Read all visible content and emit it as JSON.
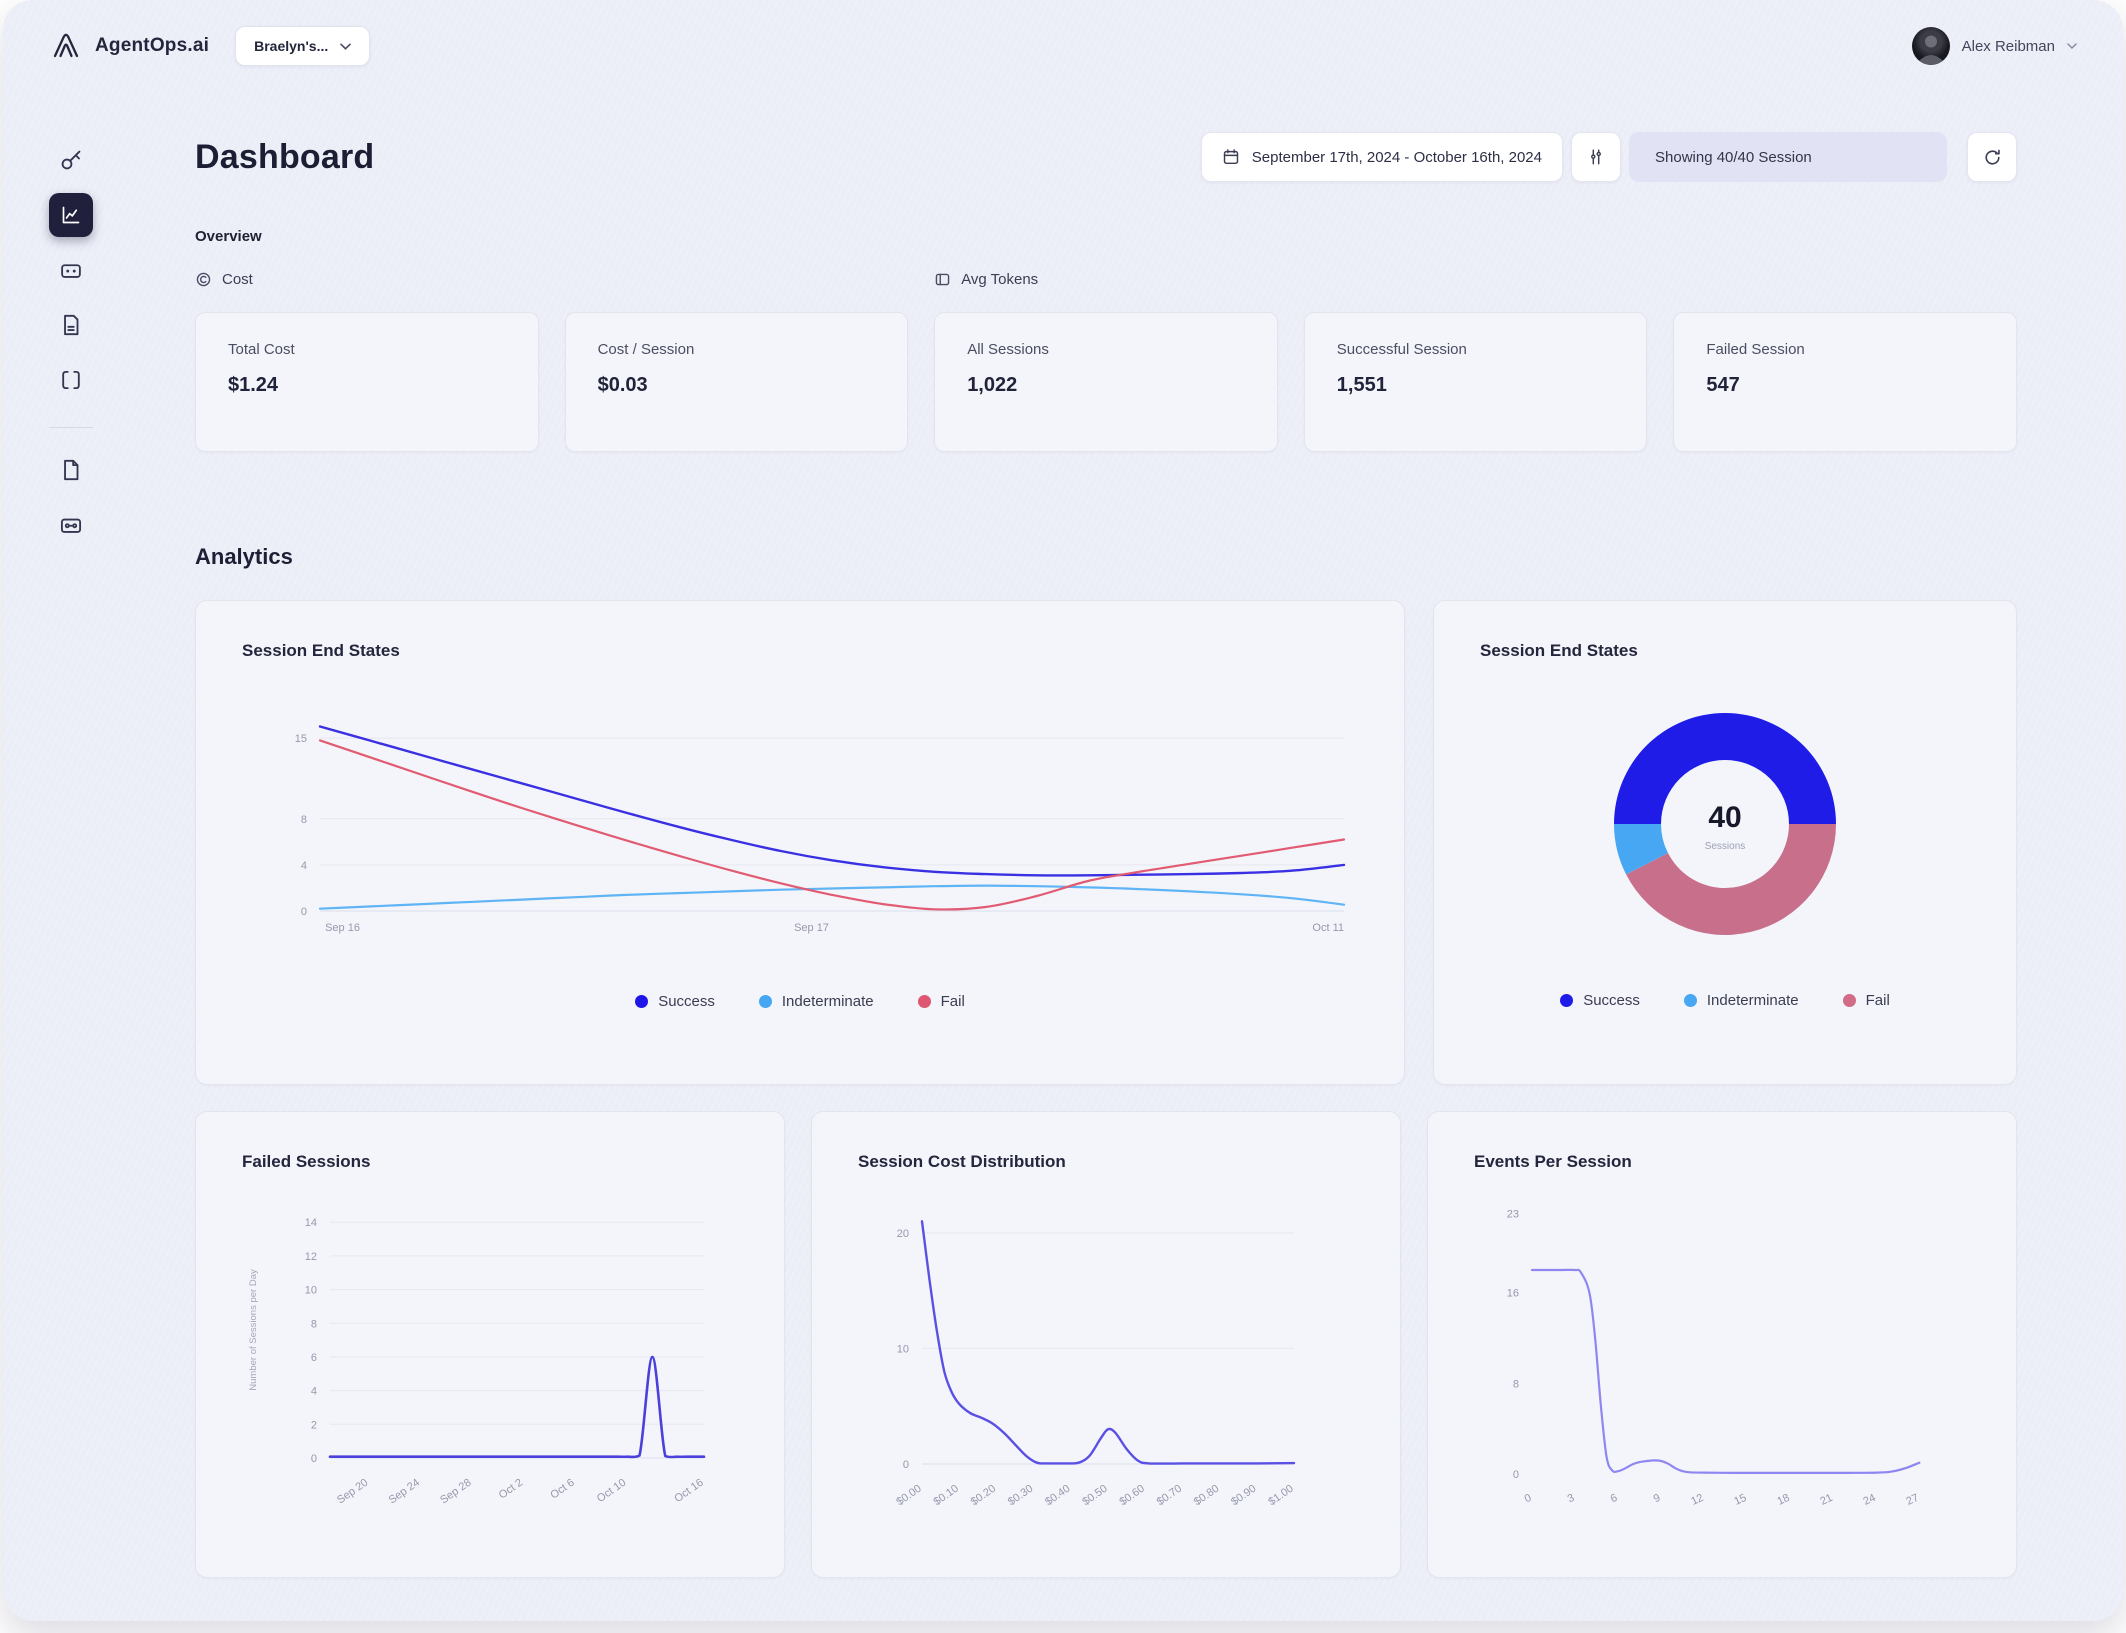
{
  "app": {
    "brand": "AgentOps.ai",
    "workspace": "Braelyn's...",
    "user_name": "Alex Reibman"
  },
  "toolbar": {
    "date_range": "September 17th, 2024 - October 16th, 2024",
    "showing": "Showing 40/40 Session"
  },
  "page": {
    "title": "Dashboard",
    "overview_heading": "Overview",
    "analytics_heading": "Analytics",
    "toggle_cost": "Cost",
    "toggle_tokens": "Avg Tokens"
  },
  "overview_cards": [
    {
      "label": "Total Cost",
      "value": "$1.24"
    },
    {
      "label": "Cost / Session",
      "value": "$0.03"
    },
    {
      "label": "All Sessions",
      "value": "1,022"
    },
    {
      "label": "Successful Session",
      "value": "1,551"
    },
    {
      "label": "Failed Session",
      "value": "547"
    }
  ],
  "chart_data": [
    {
      "id": "session-end-states-line",
      "type": "line",
      "title": "Session End States",
      "xlim": [
        0,
        1
      ],
      "ylim": [
        0,
        17
      ],
      "grid": true,
      "margins": {
        "l": 78,
        "r": 14,
        "t": 14,
        "b": 42
      },
      "yticks": [
        {
          "v": 15,
          "label": "15"
        },
        {
          "v": 8,
          "label": "8"
        },
        {
          "v": 4,
          "label": "4"
        },
        {
          "v": 0,
          "label": "0"
        }
      ],
      "xticks": [
        {
          "v": 0.005,
          "label": "Sep 16",
          "anchor": "start"
        },
        {
          "v": 0.48,
          "label": "Sep 17"
        },
        {
          "v": 1,
          "label": "Oct 11",
          "anchor": "end"
        }
      ],
      "legend": [
        {
          "name": "Success",
          "color": "#2015e8"
        },
        {
          "name": "Indeterminate",
          "color": "#45a7f2"
        },
        {
          "name": "Fail",
          "color": "#dd5672"
        }
      ],
      "series": [
        {
          "name": "Success",
          "color": "#3a30e3",
          "width": 2.4,
          "values": [
            16,
            14.75,
            13.5,
            12.25,
            11.0,
            9.75,
            8.5,
            7.3,
            6.2,
            5.2,
            4.4,
            3.8,
            3.4,
            3.2,
            3.1,
            3.1,
            3.15,
            3.2,
            3.3,
            3.5,
            4.0
          ]
        },
        {
          "name": "Indeterminate",
          "color": "#5fb4f5",
          "width": 2.2,
          "values": [
            0.2,
            0.4,
            0.6,
            0.8,
            1.0,
            1.2,
            1.4,
            1.55,
            1.7,
            1.85,
            1.95,
            2.05,
            2.15,
            2.2,
            2.15,
            2.05,
            1.9,
            1.7,
            1.45,
            1.1,
            0.55
          ]
        },
        {
          "name": "Fail",
          "color": "#e15b72",
          "width": 2.2,
          "values": [
            14.8,
            13.3,
            11.8,
            10.3,
            8.85,
            7.45,
            6.1,
            4.8,
            3.55,
            2.4,
            1.4,
            0.6,
            0.15,
            0.35,
            1.3,
            2.6,
            3.4,
            4.1,
            4.8,
            5.5,
            6.2
          ]
        }
      ]
    },
    {
      "id": "session-end-states-donut",
      "type": "donut",
      "title": "Session End States",
      "size": 222,
      "inner": 64,
      "start": 180,
      "center_value": "40",
      "center_label": "Sessions",
      "slices": [
        {
          "name": "Success",
          "value": 20,
          "color": "#1f1ce8"
        },
        {
          "name": "Fail",
          "value": 17,
          "color": "#c76f8b"
        },
        {
          "name": "Indeterminate",
          "value": 3,
          "color": "#47a7f2"
        }
      ],
      "legend": [
        {
          "name": "Success",
          "color": "#1f1ce8"
        },
        {
          "name": "Indeterminate",
          "color": "#47a7f2"
        },
        {
          "name": "Fail",
          "color": "#d16b86"
        }
      ]
    },
    {
      "id": "failed-sessions",
      "type": "line",
      "title": "Failed Sessions",
      "ylabel": "Number of Sessions per Day",
      "xlim": [
        0,
        29
      ],
      "ylim": [
        0,
        15.2
      ],
      "grid": true,
      "x_rotate": -35,
      "margins": {
        "l": 88,
        "r": 34,
        "t": 16,
        "b": 80
      },
      "yticks": [
        {
          "v": 14,
          "label": "14"
        },
        {
          "v": 12,
          "label": "12"
        },
        {
          "v": 10,
          "label": "10"
        },
        {
          "v": 8,
          "label": "8"
        },
        {
          "v": 6,
          "label": "6"
        },
        {
          "v": 4,
          "label": "4"
        },
        {
          "v": 2,
          "label": "2"
        },
        {
          "v": 0,
          "label": "0"
        }
      ],
      "xticks": [
        {
          "v": 3,
          "label": "Sep 20"
        },
        {
          "v": 7,
          "label": "Sep 24"
        },
        {
          "v": 11,
          "label": "Sep 28"
        },
        {
          "v": 15,
          "label": "Oct 2"
        },
        {
          "v": 19,
          "label": "Oct 6"
        },
        {
          "v": 23,
          "label": "Oct 10"
        },
        {
          "v": 29,
          "label": "Oct 16"
        }
      ],
      "series": [
        {
          "name": "Failed Sessions",
          "color": "#4c40dc",
          "width": 2.6,
          "values": [
            0.08,
            0.08,
            0.08,
            0.08,
            0.08,
            0.08,
            0.08,
            0.08,
            0.08,
            0.08,
            0.08,
            0.08,
            0.08,
            0.08,
            0.08,
            0.08,
            0.08,
            0.08,
            0.08,
            0.08,
            0.08,
            0.08,
            0.08,
            0.08,
            0.15,
            6,
            0.12,
            0.08,
            0.08,
            0.08
          ]
        }
      ]
    },
    {
      "id": "session-cost-distribution",
      "type": "line",
      "title": "Session Cost Distribution",
      "xlim": [
        0,
        1.0
      ],
      "ylim": [
        0,
        22.5
      ],
      "grid": true,
      "x_rotate": -35,
      "margins": {
        "l": 64,
        "r": 60,
        "t": 18,
        "b": 74
      },
      "yticks": [
        {
          "v": 20,
          "label": "20"
        },
        {
          "v": 10,
          "label": "10"
        },
        {
          "v": 0,
          "label": "0"
        }
      ],
      "xticks": [
        {
          "v": 0,
          "label": "$0.00"
        },
        {
          "v": 0.1,
          "label": "$0.10"
        },
        {
          "v": 0.2,
          "label": "$0.20"
        },
        {
          "v": 0.3,
          "label": "$0.30"
        },
        {
          "v": 0.4,
          "label": "$0.40"
        },
        {
          "v": 0.5,
          "label": "$0.50"
        },
        {
          "v": 0.6,
          "label": "$0.60"
        },
        {
          "v": 0.7,
          "label": "$0.70"
        },
        {
          "v": 0.8,
          "label": "$0.80"
        },
        {
          "v": 0.9,
          "label": "$0.90"
        },
        {
          "v": 1.0,
          "label": "$1.00"
        }
      ],
      "series": [
        {
          "name": "Sessions",
          "color": "#5a50e4",
          "width": 2.4,
          "values": [
            [
              0,
              21
            ],
            [
              0.02,
              16
            ],
            [
              0.04,
              11.5
            ],
            [
              0.06,
              8
            ],
            [
              0.08,
              6.2
            ],
            [
              0.1,
              5.2
            ],
            [
              0.13,
              4.4
            ],
            [
              0.16,
              4.0
            ],
            [
              0.19,
              3.5
            ],
            [
              0.22,
              2.7
            ],
            [
              0.25,
              1.7
            ],
            [
              0.28,
              0.7
            ],
            [
              0.31,
              0.1
            ],
            [
              0.34,
              0.05
            ],
            [
              0.38,
              0.05
            ],
            [
              0.42,
              0.1
            ],
            [
              0.45,
              0.7
            ],
            [
              0.48,
              2.2
            ],
            [
              0.5,
              3.0
            ],
            [
              0.52,
              2.7
            ],
            [
              0.55,
              1.3
            ],
            [
              0.58,
              0.3
            ],
            [
              0.61,
              0.05
            ],
            [
              0.7,
              0.05
            ],
            [
              0.8,
              0.05
            ],
            [
              0.9,
              0.05
            ],
            [
              1.0,
              0.08
            ]
          ]
        }
      ]
    },
    {
      "id": "events-per-session",
      "type": "line",
      "title": "Events Per Session",
      "xlim": [
        0,
        27.6
      ],
      "ylim": [
        0,
        24
      ],
      "grid": false,
      "x_rotate": -25,
      "margins": {
        "l": 58,
        "r": 42,
        "t": 16,
        "b": 64
      },
      "yticks": [
        {
          "v": 23,
          "label": "23"
        },
        {
          "v": 16,
          "label": "16"
        },
        {
          "v": 8,
          "label": "8"
        },
        {
          "v": 0,
          "label": "0"
        }
      ],
      "xticks": [
        {
          "v": 0,
          "label": "0"
        },
        {
          "v": 3,
          "label": "3"
        },
        {
          "v": 6,
          "label": "6"
        },
        {
          "v": 9,
          "label": "9"
        },
        {
          "v": 12,
          "label": "12"
        },
        {
          "v": 15,
          "label": "15"
        },
        {
          "v": 18,
          "label": "18"
        },
        {
          "v": 21,
          "label": "21"
        },
        {
          "v": 24,
          "label": "24"
        },
        {
          "v": 27,
          "label": "27"
        }
      ],
      "series": [
        {
          "name": "Events",
          "color": "#8e87f1",
          "width": 2.2,
          "values": [
            [
              0,
              18
            ],
            [
              1,
              18
            ],
            [
              2,
              18
            ],
            [
              3,
              18
            ],
            [
              3.4,
              17.8
            ],
            [
              4,
              16
            ],
            [
              4.4,
              12
            ],
            [
              4.8,
              6
            ],
            [
              5.2,
              1.5
            ],
            [
              5.6,
              0.3
            ],
            [
              6,
              0.25
            ],
            [
              6.5,
              0.5
            ],
            [
              7,
              0.85
            ],
            [
              7.5,
              1.05
            ],
            [
              8,
              1.15
            ],
            [
              8.5,
              1.2
            ],
            [
              9,
              1.15
            ],
            [
              9.5,
              0.9
            ],
            [
              10,
              0.5
            ],
            [
              10.5,
              0.25
            ],
            [
              11,
              0.15
            ],
            [
              12,
              0.12
            ],
            [
              14,
              0.1
            ],
            [
              16,
              0.1
            ],
            [
              18,
              0.1
            ],
            [
              20,
              0.1
            ],
            [
              22,
              0.1
            ],
            [
              24,
              0.12
            ],
            [
              25,
              0.2
            ],
            [
              26,
              0.5
            ],
            [
              27,
              1.0
            ]
          ]
        }
      ]
    }
  ]
}
